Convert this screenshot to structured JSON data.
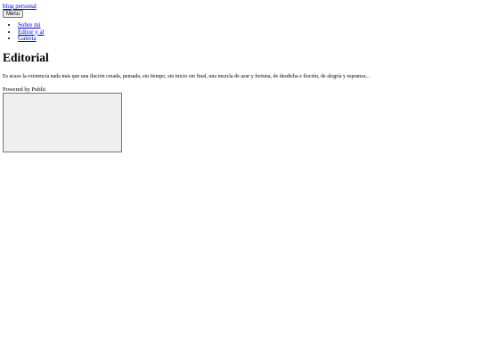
{
  "header": {
    "logo_alt": "blog personal",
    "menu_button_label": "Menu"
  },
  "nav": {
    "items": [
      {
        "label": "Sobre mi"
      },
      {
        "label": "Editor y al"
      },
      {
        "label": "Galeria"
      }
    ]
  },
  "article": {
    "title": "Editorial",
    "body": "Es acaso la existencia nada más que una ilución creada, pensada, sin tiempo, sin inicio sin final, una mezcla de azar y fortuna, de desdicha e ilución, de alegría y espranza..."
  },
  "footer": {
    "powered_by": "Powered by Publii"
  }
}
